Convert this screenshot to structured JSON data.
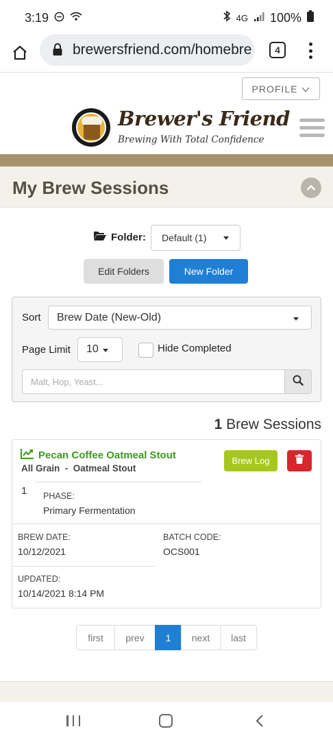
{
  "status": {
    "time": "3:19",
    "battery": "100%",
    "network": "4G"
  },
  "browser": {
    "url": "brewersfriend.com/homebre",
    "tab_count": "4"
  },
  "header": {
    "profile_label": "PROFILE",
    "brand_name": "Brewer's Friend",
    "tagline": "Brewing With Total Confidence"
  },
  "section": {
    "title": "My Brew Sessions"
  },
  "folder": {
    "label": "Folder:",
    "selected": "Default (1)",
    "edit_label": "Edit Folders",
    "new_label": "New Folder"
  },
  "filters": {
    "sort_label": "Sort",
    "sort_selected": "Brew Date (New-Old)",
    "limit_label": "Page Limit",
    "limit_selected": "10",
    "hide_completed_label": "Hide Completed",
    "hide_completed_checked": false,
    "search_placeholder": "Malt, Hop, Yeast..."
  },
  "results": {
    "count": "1",
    "count_label": "Brew Sessions"
  },
  "session": {
    "recipe_name": "Pecan Coffee Oatmeal Stout",
    "method": "All Grain",
    "separator": "-",
    "style": "Oatmeal Stout",
    "brewlog_label": "Brew Log",
    "phase_number": "1",
    "phase_label": "PHASE:",
    "phase_value": "Primary Fermentation",
    "brew_date_label": "BREW DATE:",
    "brew_date": "10/12/2021",
    "batch_code_label": "BATCH CODE:",
    "batch_code": "OCS001",
    "updated_label": "UPDATED:",
    "updated": "10/14/2021 8:14 PM"
  },
  "pagination": {
    "first": "first",
    "prev": "prev",
    "current": "1",
    "next": "next",
    "last": "last"
  },
  "colors": {
    "primary_blue": "#1f7fd4",
    "recipe_green": "#3d9b1f",
    "brewlog_lime": "#a6c81e",
    "delete_red": "#d9252d",
    "brand_brown": "#a8926b"
  }
}
